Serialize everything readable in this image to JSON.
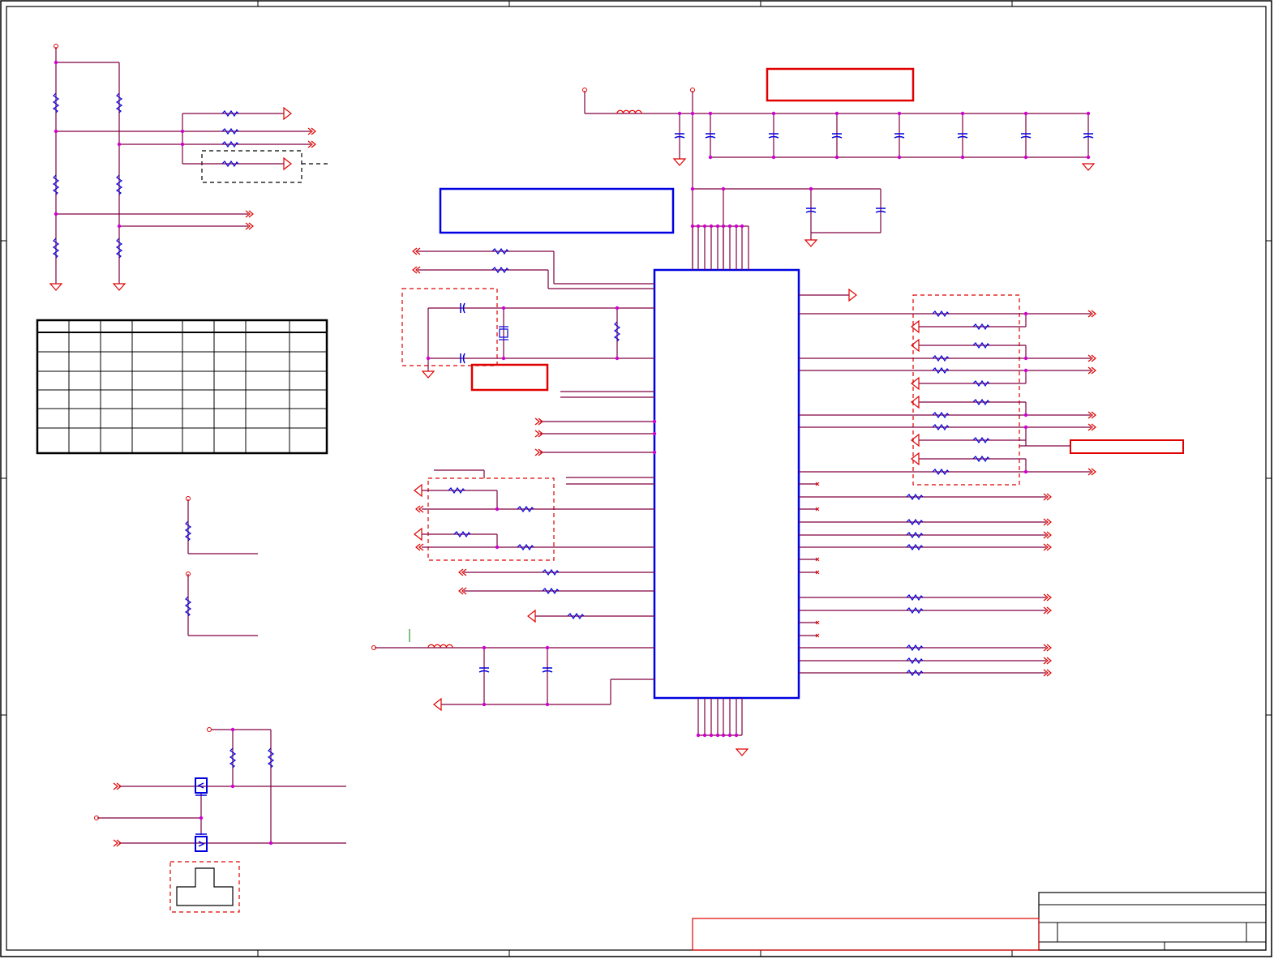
{
  "sheet": {
    "title": "",
    "colors": {
      "wire": "#800040",
      "net_symbol": "#e00000",
      "component": "#0000e0",
      "junction": "#d000d0",
      "frame": "#000000"
    }
  },
  "blocks": {
    "ic_main": {
      "label": ""
    },
    "note_top_red": {
      "label": ""
    },
    "note_blue": {
      "label": ""
    },
    "note_crystal_red": {
      "label": ""
    },
    "note_right_red": {
      "label": ""
    },
    "config_table": {
      "columns": 8,
      "rows": 6
    },
    "title_block": {
      "label": ""
    }
  },
  "icons": {
    "resistor": "resistor-icon",
    "capacitor": "capacitor-icon",
    "inductor": "inductor-icon",
    "crystal": "crystal-icon",
    "ground": "ground-icon",
    "power": "power-port-icon",
    "net_arrow": "net-arrow-icon",
    "offpage": "offpage-connector-icon",
    "mosfet": "mosfet-icon"
  }
}
